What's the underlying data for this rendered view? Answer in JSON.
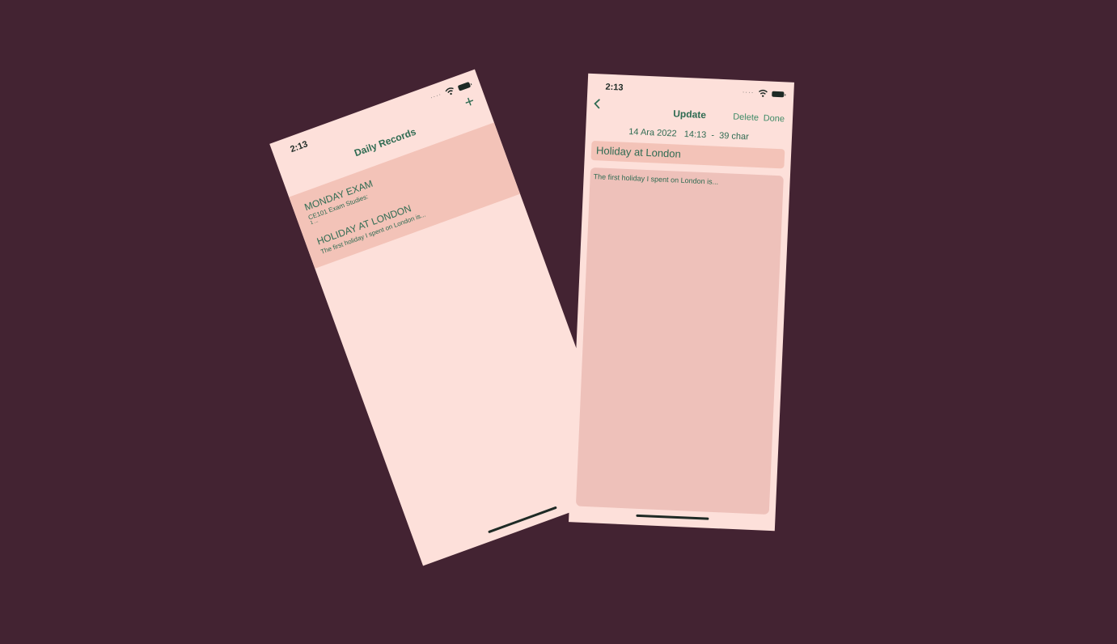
{
  "list_screen": {
    "status_time": "2:13",
    "title": "Daily Records",
    "add_icon": "plus-icon",
    "records": [
      {
        "title": "MONDAY EXAM",
        "subtitle": "CE101 Exam Studies:",
        "more": "1 ..."
      },
      {
        "title": "HOLIDAY AT LONDON",
        "subtitle": "The first holiday I spent on London is..."
      }
    ]
  },
  "edit_screen": {
    "status_time": "2:13",
    "back_icon": "chevron-left-icon",
    "title": "Update",
    "delete_label": "Delete",
    "done_label": "Done",
    "meta": "14 Ara 2022   14:13  -  39 char",
    "record_title": "Holiday at London",
    "record_body": "The first holiday I spent on London is..."
  },
  "colors": {
    "background": "#432332",
    "screen": "#fde0da",
    "row": "#f3c3b8",
    "accent": "#2f6b52"
  }
}
